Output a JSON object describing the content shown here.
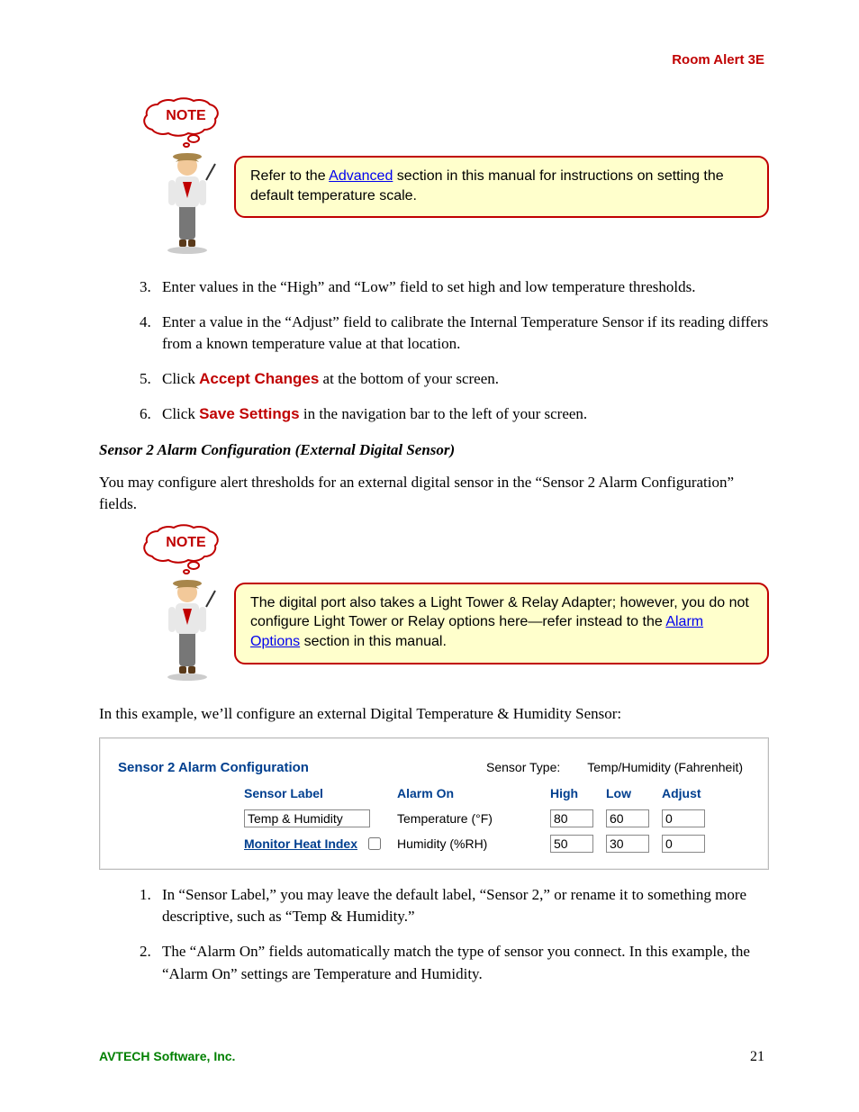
{
  "header": {
    "product": "Room Alert 3E"
  },
  "note1": {
    "bubble": "NOTE",
    "text_pre": "Refer to the ",
    "link": "Advanced",
    "text_post": " section in this manual for instructions on setting the default temperature scale."
  },
  "steps_a": {
    "start": 3,
    "items": [
      "Enter values in the “High” and “Low” field to set high and low temperature thresholds.",
      "Enter a value in the “Adjust” field to calibrate the Internal Temperature Sensor if its reading differs from a known temperature value at that location.",
      {
        "pre": "Click ",
        "action": "Accept Changes",
        "post": " at the bottom of your screen."
      },
      {
        "pre": "Click ",
        "action": "Save Settings",
        "post": " in the navigation bar to the left of your screen."
      }
    ]
  },
  "subheading": "Sensor 2 Alarm Configuration (External Digital Sensor)",
  "para1": "You may configure alert thresholds for an external digital sensor in the “Sensor 2 Alarm Configuration” fields.",
  "note2": {
    "bubble": "NOTE",
    "text_pre": "The digital port also takes a Light Tower & Relay Adapter; however, you do not configure Light Tower or Relay options here—refer instead to the ",
    "link": "Alarm Options",
    "text_post": " section in this manual."
  },
  "para2": "In this example, we’ll configure an external Digital Temperature & Humidity Sensor:",
  "config": {
    "title": "Sensor 2 Alarm Configuration",
    "sensor_type_label": "Sensor Type:",
    "sensor_type_value": "Temp/Humidity (Fahrenheit)",
    "headers": {
      "label": "Sensor Label",
      "alarm_on": "Alarm On",
      "high": "High",
      "low": "Low",
      "adjust": "Adjust"
    },
    "row1": {
      "label": "Temp & Humidity",
      "alarm_on": "Temperature (°F)",
      "high": "80",
      "low": "60",
      "adjust": "0"
    },
    "row2": {
      "mhi": "Monitor Heat Index",
      "alarm_on": "Humidity (%RH)",
      "high": "50",
      "low": "30",
      "adjust": "0"
    }
  },
  "steps_b": {
    "start": 1,
    "items": [
      "In “Sensor Label,” you may leave the default label, “Sensor 2,” or rename it to something more descriptive, such as “Temp & Humidity.”",
      " The “Alarm On” fields automatically match the type of sensor you connect. In this example, the “Alarm On” settings are Temperature and Humidity."
    ]
  },
  "footer": {
    "company": "AVTECH Software, Inc.",
    "page": "21"
  }
}
